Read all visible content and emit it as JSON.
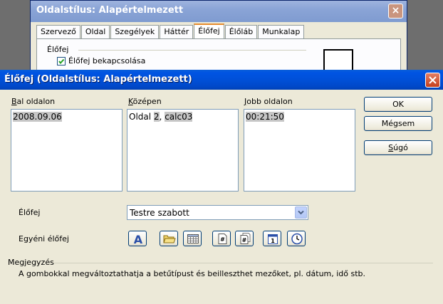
{
  "background_dialog": {
    "title": "Oldalstílus: Alapértelmezett",
    "close": "×",
    "tabs": [
      "Szervező",
      "Oldal",
      "Szegélyek",
      "Háttér",
      "Élőfej",
      "Élőláb",
      "Munkalap"
    ],
    "active_tab": "Élőfej",
    "section_label": "Élőfej",
    "checkbox_label": "Élőfej bekapcsolása",
    "checkbox_checked": true
  },
  "dialog": {
    "title": "Élőfej (Oldalstílus: Alapértelmezett)",
    "left": {
      "label_key": "B",
      "label_rest": "al oldalon",
      "content": "2008.09.06"
    },
    "center": {
      "label_key": "K",
      "label_rest": "özépen",
      "content_prefix": "Oldal ",
      "field1": "2",
      "sep": ", ",
      "field2": "calc03"
    },
    "right": {
      "label_key": "J",
      "label_rest": "obb oldalon",
      "content": "00:21:50"
    },
    "buttons": {
      "ok": "OK",
      "cancel": "Mégsem",
      "help_key": "S",
      "help_rest": "úgó"
    },
    "header_label": "Élőfej",
    "header_select_value": "Testre szabott",
    "custom_header_label": "Egyéni élőfej",
    "toolbar_icons": [
      "text-attributes-icon",
      "file-name-icon",
      "sheet-name-icon",
      "page-number-icon",
      "page-count-icon",
      "date-icon",
      "time-icon"
    ],
    "note_label": "Megjegyzés",
    "note_text": "A gombokkal megváltoztathatja a betűtípust és beilleszthet mezőket, pl. dátum, idő stb."
  },
  "colors": {
    "titlebar": "#0054e3",
    "selection": "#c6c6c6",
    "dialog_bg": "#ece9d8"
  }
}
